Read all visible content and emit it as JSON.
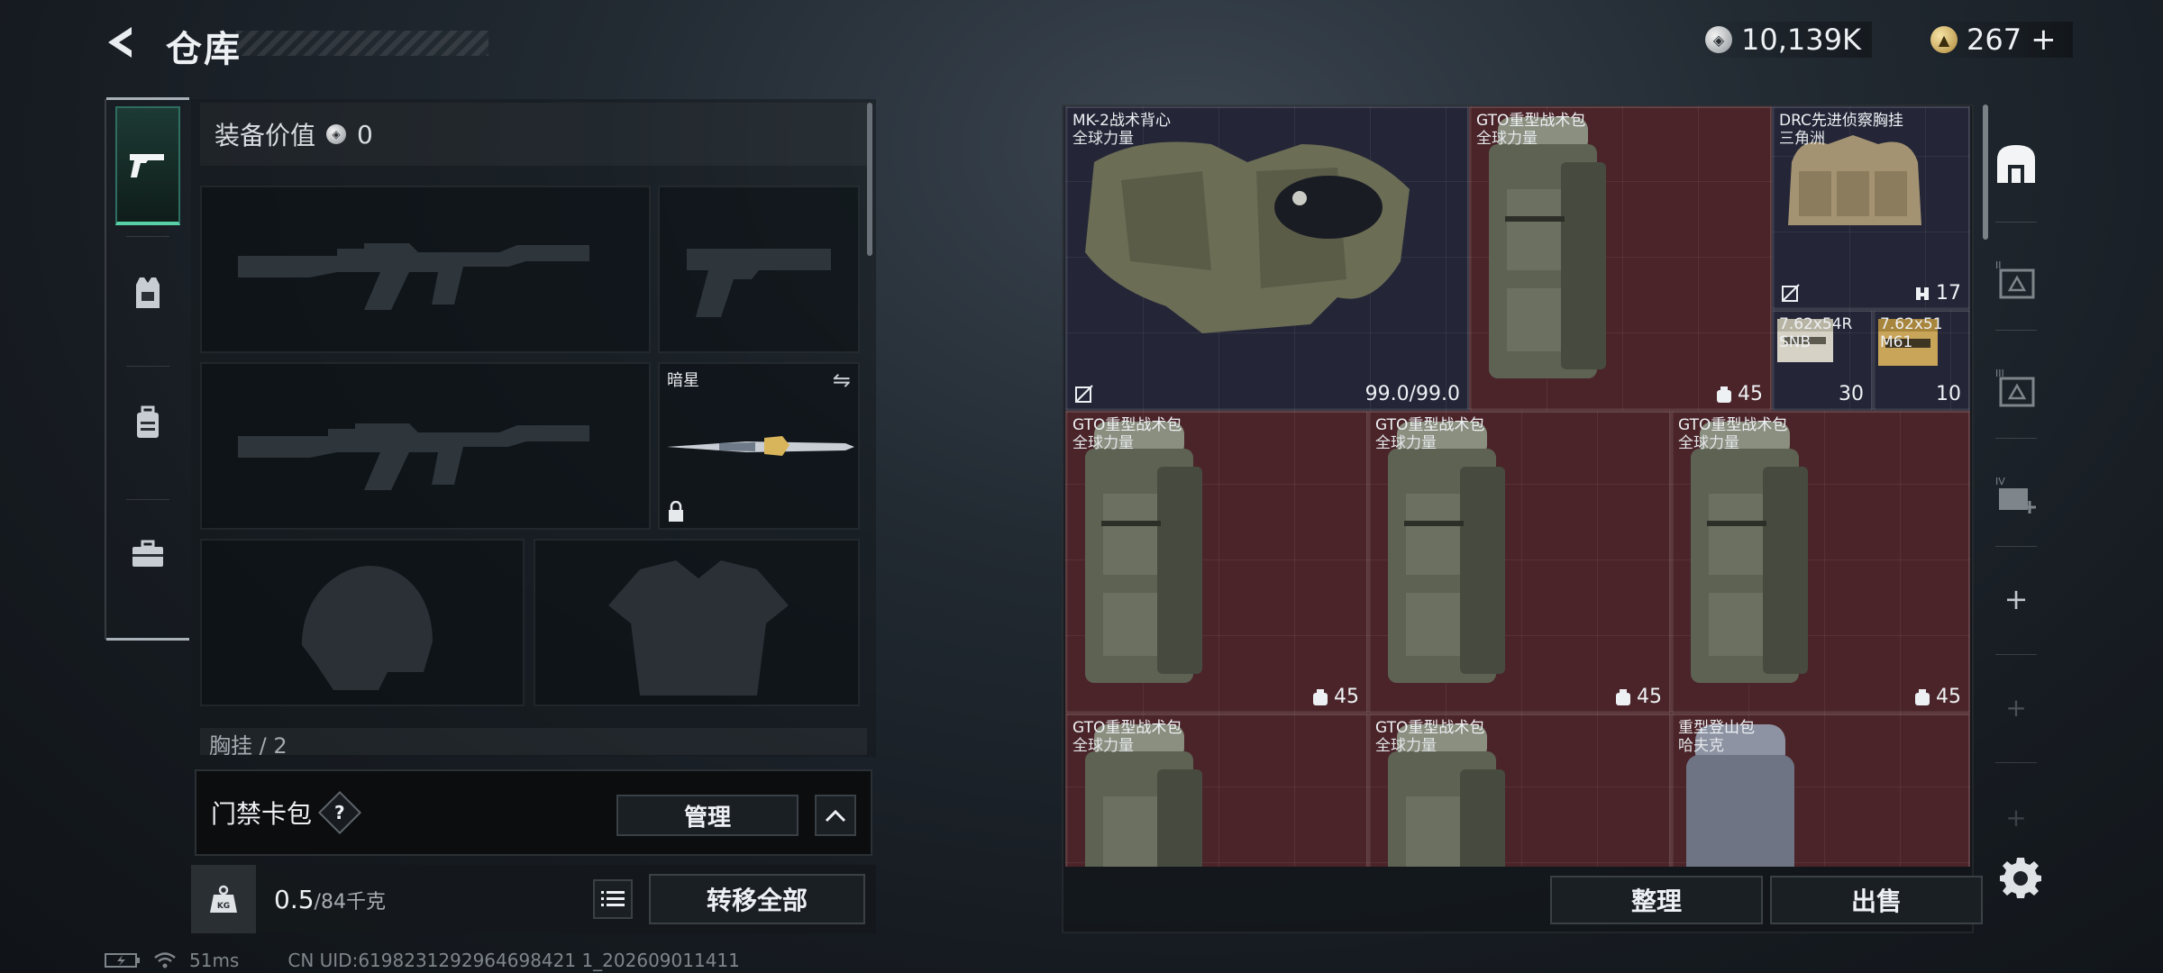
{
  "header": {
    "title": "仓库",
    "currency_silver": "10,139K",
    "currency_gold": "267",
    "currency_gold_plus": "+"
  },
  "equipment": {
    "value_label": "装备价值",
    "value_amount": "0",
    "melee_slot_label": "暗星",
    "partial_label": "胸挂 / 2"
  },
  "keycard": {
    "label": "门禁卡包",
    "help": "?",
    "manage_label": "管理"
  },
  "weight": {
    "current": "0.5",
    "max": "/84千克",
    "kg_icon_text": "KG",
    "transfer_all_label": "转移全部"
  },
  "status": {
    "latency": "51ms",
    "uid": "CN UID:6198231292964698421 1_202609011411"
  },
  "stash": {
    "items": [
      {
        "name": "MK-2战术背心",
        "sub": "全球力量",
        "count": "99.0/99.0"
      },
      {
        "name": "GTO重型战术包",
        "sub": "全球力量",
        "count": "45"
      },
      {
        "name": "DRC先进侦察胸挂",
        "sub": "三角洲",
        "count": "17"
      },
      {
        "name": "7.62x54R SNB",
        "sub": "",
        "count": "30"
      },
      {
        "name": "7.62x51 M61",
        "sub": "",
        "count": "10"
      },
      {
        "name": "GTO重型战术包",
        "sub": "全球力量",
        "count": "45"
      },
      {
        "name": "GTO重型战术包",
        "sub": "全球力量",
        "count": "45"
      },
      {
        "name": "GTO重型战术包",
        "sub": "全球力量",
        "count": "45"
      },
      {
        "name": "GTO重型战术包",
        "sub": "全球力量",
        "count": ""
      },
      {
        "name": "GTO重型战术包",
        "sub": "全球力量",
        "count": ""
      },
      {
        "name": "重型登山包",
        "sub": "哈夫克",
        "count": ""
      }
    ],
    "sort_label": "整理",
    "sell_label": "出售"
  },
  "right_rail": {
    "tabs": [
      "I",
      "II",
      "III",
      "IV"
    ]
  },
  "colors": {
    "accent_green": "#57d0a6",
    "cell_maroon": "#4a2429",
    "cell_navy": "#242637"
  }
}
